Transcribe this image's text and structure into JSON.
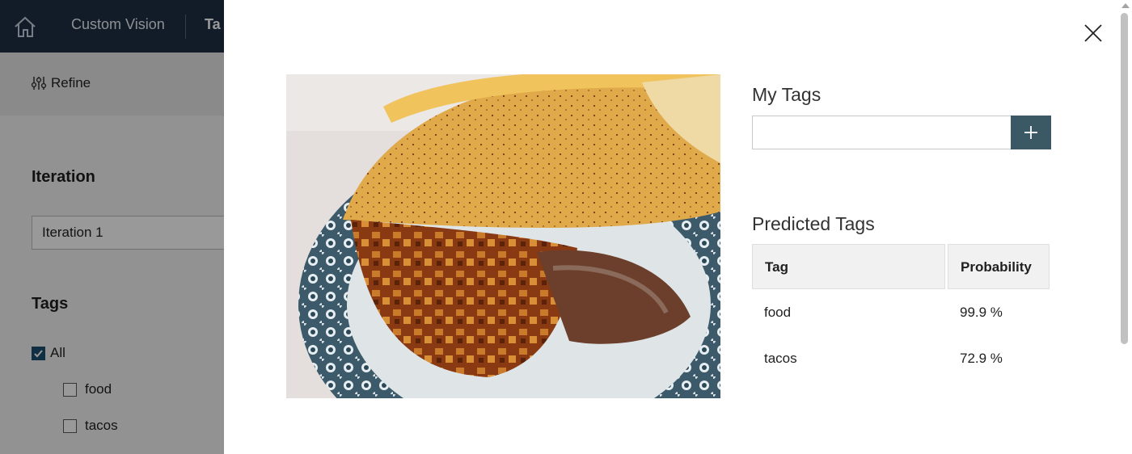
{
  "topbar": {
    "brand": "Custom Vision",
    "tab_partial": "Ta"
  },
  "toolbar": {
    "refine_label": "Refine"
  },
  "sidebar": {
    "iteration_heading": "Iteration",
    "iteration_value": "Iteration 1",
    "tags_heading": "Tags",
    "tag_filters": [
      {
        "label": "All",
        "checked": true
      },
      {
        "label": "food",
        "checked": false
      },
      {
        "label": "tacos",
        "checked": false
      }
    ]
  },
  "modal": {
    "image_alt": "taco with potatoes on a blue patterned plate",
    "my_tags": {
      "heading": "My Tags",
      "input_value": "",
      "input_placeholder": "",
      "add_icon": "plus-icon"
    },
    "predicted_tags": {
      "heading": "Predicted Tags",
      "columns": [
        "Tag",
        "Probability"
      ],
      "rows": [
        {
          "tag": "food",
          "probability": "99.9 %"
        },
        {
          "tag": "tacos",
          "probability": "72.9 %"
        }
      ]
    },
    "close_icon": "close-icon"
  },
  "colors": {
    "topbar_bg": "#1f3044",
    "add_button_bg": "#3b5964",
    "checkbox_checked": "#1d4f6e"
  }
}
